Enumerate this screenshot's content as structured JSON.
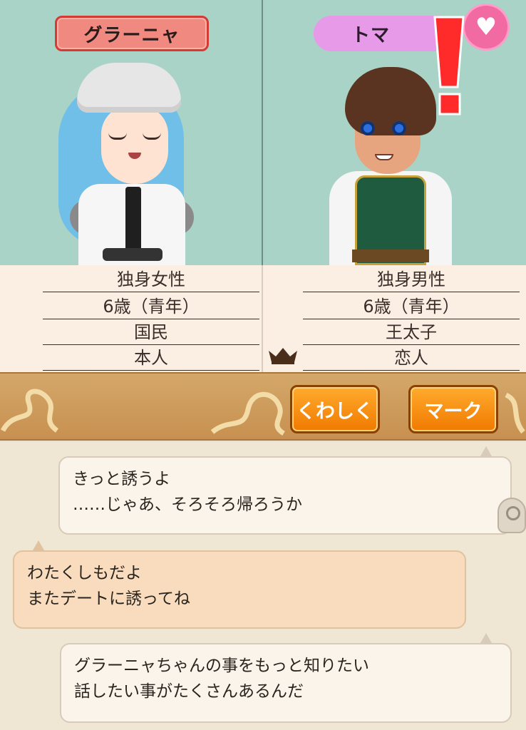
{
  "characters": {
    "left": {
      "name": "グラーニャ",
      "info": [
        "独身女性",
        "6歳（青年）",
        "国民",
        "本人"
      ]
    },
    "right": {
      "name": "トマ",
      "info": [
        "独身男性",
        "6歳（青年）",
        "王太子",
        "恋人"
      ]
    }
  },
  "buttons": {
    "detail_label": "くわしく",
    "mark_label": "マーク"
  },
  "dialogue": [
    {
      "speaker": "right",
      "lines": [
        "きっと誘うよ",
        "……じゃあ、そろそろ帰ろうか"
      ]
    },
    {
      "speaker": "left",
      "lines": [
        "わたくしもだよ",
        "またデートに誘ってね"
      ]
    },
    {
      "speaker": "right",
      "lines": [
        "グラーニャちゃんの事をもっと知りたい",
        "話したい事がたくさんあるんだ"
      ]
    }
  ],
  "colors": {
    "female_plate": "#f0897f",
    "male_plate": "#e79ae8",
    "button_orange": "#f07a00",
    "portrait_bg": "#a8d3c6"
  },
  "icons": [
    "heart-icon",
    "exclamation-icon",
    "crown-icon",
    "tap-icon"
  ]
}
